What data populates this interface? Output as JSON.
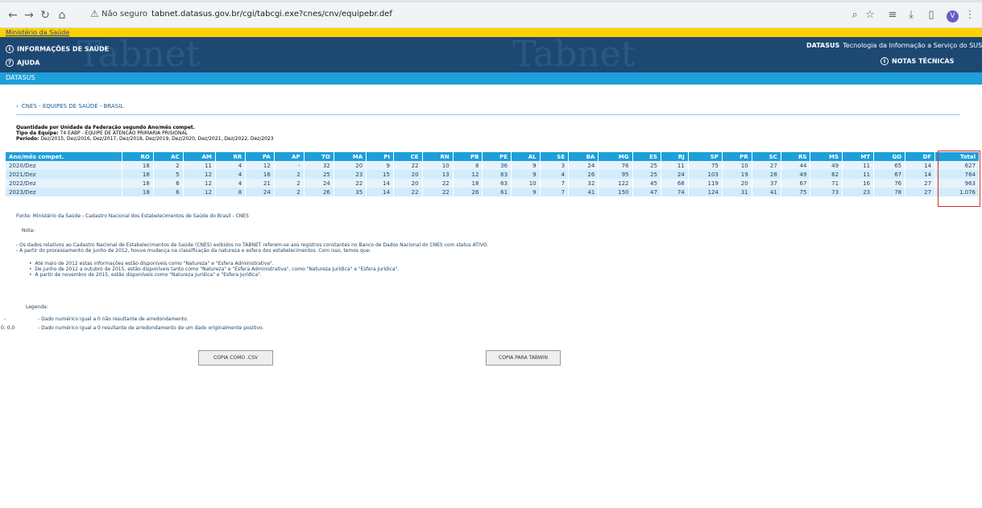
{
  "browser": {
    "security_label": "Não seguro",
    "url": "tabnet.datasus.gov.br/cgi/tabcgi.exe?cnes/cnv/equipebr.def",
    "profile_initial": "V"
  },
  "ministry_link": "Ministério da Saúde",
  "header": {
    "menu_info": "INFORMAÇÕES DE SAÚDE",
    "menu_help": "AJUDA",
    "datasus_name": "DATASUS",
    "datasus_tagline": "Tecnologia da Informação a Serviço do SUS",
    "notas_tecnicas": "NOTAS TÉCNICAS",
    "watermark": "Tabnet"
  },
  "subbar": "DATASUS",
  "breadcrumb": "CNES - EQUIPES DE SAÚDE - BRASIL",
  "meta": {
    "title": "Quantidade por Unidade da Federação segundo Ano/mês compet.",
    "tipo_label": "Tipo da Equipe:",
    "tipo_value": "74 EABP - EQUIPE DE ATENCAO PRIMARIA PRISIONAL",
    "periodo_label": "Período:",
    "periodo_value": "Dez/2015, Dez/2016, Dez/2017, Dez/2018, Dez/2019, Dez/2020, Dez/2021, Dez/2022, Dez/2023"
  },
  "table": {
    "headers": [
      "Ano/mês compet.",
      "RO",
      "AC",
      "AM",
      "RR",
      "PA",
      "AP",
      "TO",
      "MA",
      "PI",
      "CE",
      "RN",
      "PB",
      "PE",
      "AL",
      "SE",
      "BA",
      "MG",
      "ES",
      "RJ",
      "SP",
      "PR",
      "SC",
      "RS",
      "MS",
      "MT",
      "GO",
      "DF",
      "Total"
    ],
    "rows": [
      [
        "2020/Dez",
        "18",
        "2",
        "11",
        "4",
        "12",
        "-",
        "32",
        "20",
        "9",
        "22",
        "10",
        "8",
        "36",
        "9",
        "3",
        "24",
        "76",
        "25",
        "11",
        "75",
        "10",
        "27",
        "44",
        "49",
        "11",
        "65",
        "14",
        "627"
      ],
      [
        "2021/Dez",
        "18",
        "5",
        "12",
        "4",
        "16",
        "2",
        "25",
        "23",
        "15",
        "20",
        "13",
        "12",
        "63",
        "9",
        "4",
        "26",
        "95",
        "25",
        "24",
        "103",
        "19",
        "28",
        "49",
        "62",
        "11",
        "67",
        "14",
        "764"
      ],
      [
        "2022/Dez",
        "18",
        "6",
        "12",
        "4",
        "21",
        "2",
        "24",
        "22",
        "14",
        "20",
        "22",
        "18",
        "63",
        "10",
        "7",
        "32",
        "122",
        "45",
        "68",
        "119",
        "20",
        "37",
        "67",
        "71",
        "16",
        "76",
        "27",
        "963"
      ],
      [
        "2023/Dez",
        "18",
        "6",
        "12",
        "8",
        "24",
        "2",
        "26",
        "35",
        "14",
        "22",
        "22",
        "26",
        "61",
        "9",
        "7",
        "41",
        "150",
        "47",
        "74",
        "124",
        "31",
        "41",
        "75",
        "73",
        "23",
        "78",
        "27",
        "1.076"
      ]
    ]
  },
  "fonte": "Fonte: Ministério da Saúde - Cadastro Nacional dos Estabelecimentos de Saúde do Brasil - CNES",
  "nota_label": "Nota:",
  "nota_lines": [
    "- Os dados relativos ao Cadastro Nacional de Estabelecimentos de Saúde (CNES) exibidos no TABNET referem-se aos registros constantes no Banco de Dados Nacional do CNES com status ATIVO.",
    "- A partir do processamento de junho de 2012, houve mudança na classificação da natureza e esfera dos estabelecimentos. Com isso, temos que:"
  ],
  "nota_bullets": [
    "Até maio de 2012 estas informações estão disponíveis como \"Natureza\" e \"Esfera Administrativa\".",
    "De junho de 2012 a outubro de 2015, estão disponíveis tanto como \"Natureza\" e \"Esfera Administrativa\", como \"Natureza Jurídica\" e \"Esfera Jurídica\".",
    "A partir de novembro de 2015, estão disponíveis como \"Natureza Jurídica\" e \"Esfera Jurídica\"."
  ],
  "legenda_label": "Legenda:",
  "legenda": [
    {
      "symbol": "-",
      "text": "- Dado numérico igual a 0 não resultante de arredondamento."
    },
    {
      "symbol": "0; 0,0",
      "text": "- Dado numérico igual a 0 resultante de arredondamento de um dado originalmente positivo."
    }
  ],
  "buttons": {
    "csv": "COPIA COMO .CSV",
    "tabwin": "COPIA PARA TABWIN"
  },
  "colors": {
    "header_dark": "#1d4872",
    "header_light": "#1d9fda",
    "ministry_yellow": "#ffd100",
    "highlight": "#d0312d"
  }
}
